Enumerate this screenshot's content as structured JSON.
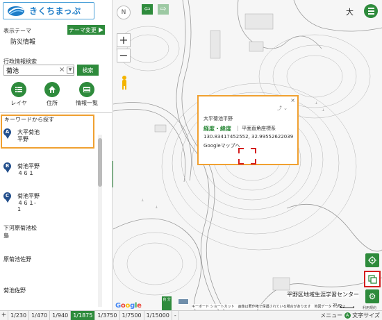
{
  "header": {
    "logo_text": "きくちまっぷ"
  },
  "theme": {
    "label": "表示テーマ",
    "value": "防災情報",
    "change_button": "テーマ変更 ▶"
  },
  "search": {
    "label": "行政情報検索",
    "input_value": "菊池",
    "clear_glyph": "×",
    "button": "検索"
  },
  "tools": {
    "layer": "レイヤ",
    "address": "住所",
    "list": "情報一覧"
  },
  "results": {
    "keyword_title": "キーワードから探す",
    "items": [
      {
        "marker": "A",
        "name": "大平菊池",
        "addr": "平野",
        "addr2": ""
      },
      {
        "marker": "B",
        "name": "菊池平野",
        "addr": "４６１",
        "addr2": ""
      },
      {
        "marker": "C",
        "name": "菊池平野",
        "addr": "４６１-",
        "addr2": "1"
      }
    ],
    "plain_items": [
      "下河原菊池松",
      "島",
      "原菊池佐野",
      "菊池佐野"
    ]
  },
  "map": {
    "compass_glyph": "N",
    "zoom_in": "+",
    "zoom_out": "−",
    "nav_back": "⇦",
    "nav_forward": "⇨",
    "big_text_label": "大",
    "popup": {
      "title": "大平菊池平野",
      "coord_tab": "経度・緯度",
      "separator": "|",
      "plane_tab": "平面直角座標系",
      "coords": "130.83417452552, 32.99552622039",
      "google_link": "Googleマップへ",
      "close": "×",
      "top_icons": "⤴ ⌄"
    },
    "center_label": "平野区地域生涯学習センター",
    "google_letters": [
      "G",
      "o",
      "o",
      "g",
      "l",
      "e"
    ],
    "streetview_label": "自 分",
    "attribution": "キーボード ショートカット　画像は著作権で保護されている場合があります　地図データ ©2022",
    "scale_text": "20 m",
    "terms": "利用規約"
  },
  "bottom": {
    "toggle": "+",
    "scales": [
      "1/230",
      "1/470",
      "1/940",
      "1/1875",
      "1/3750",
      "1/7500",
      "1/15000",
      "-"
    ],
    "active_scale": "1/1875",
    "menu": "メニュー",
    "text_size": "文字サイズ"
  },
  "colors": {
    "accent_green": "#2e8b3c",
    "highlight_orange": "#f0a030",
    "marker_blue": "#234f8c",
    "alert_red": "#d41e1e"
  }
}
